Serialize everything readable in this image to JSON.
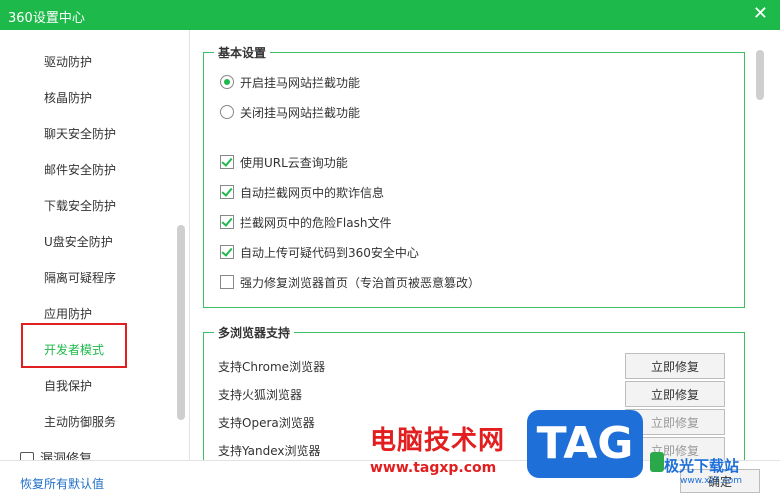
{
  "window": {
    "title": "360设置中心",
    "close": "✕"
  },
  "sidebar": {
    "items": [
      {
        "label": "驱动防护"
      },
      {
        "label": "核晶防护"
      },
      {
        "label": "聊天安全防护"
      },
      {
        "label": "邮件安全防护"
      },
      {
        "label": "下载安全防护"
      },
      {
        "label": "U盘安全防护"
      },
      {
        "label": "隔离可疑程序"
      },
      {
        "label": "应用防护"
      },
      {
        "label": "开发者模式",
        "active": true
      },
      {
        "label": "自我保护"
      },
      {
        "label": "主动防御服务"
      }
    ],
    "group_label": "漏洞修复"
  },
  "basic": {
    "legend": "基本设置",
    "radio_on": "开启挂马网站拦截功能",
    "radio_off": "关闭挂马网站拦截功能",
    "checks": [
      {
        "label": "使用URL云查询功能",
        "checked": true
      },
      {
        "label": "自动拦截网页中的欺诈信息",
        "checked": true
      },
      {
        "label": "拦截网页中的危险Flash文件",
        "checked": true
      },
      {
        "label": "自动上传可疑代码到360安全中心",
        "checked": true
      },
      {
        "label": "强力修复浏览器首页（专治首页被恶意篡改）",
        "checked": false
      }
    ]
  },
  "browsers": {
    "legend": "多浏览器支持",
    "rows": [
      {
        "label": "支持Chrome浏览器",
        "button": "立即修复"
      },
      {
        "label": "支持火狐浏览器",
        "button": "立即修复"
      },
      {
        "label": "支持Opera浏览器",
        "button": "立即修复"
      },
      {
        "label": "支持Yandex浏览器",
        "button": "立即修复"
      }
    ]
  },
  "footer": {
    "restore": "恢复所有默认值",
    "ok": "确定"
  },
  "watermark": {
    "text": "电脑技术网",
    "url": "www.tagxp.com",
    "tag": "TAG",
    "site": "极光下载站",
    "site_url": "www.xz7.com"
  },
  "colors": {
    "accent": "#1db94a",
    "highlight_box": "#e02020",
    "link": "#1d6fc9"
  }
}
